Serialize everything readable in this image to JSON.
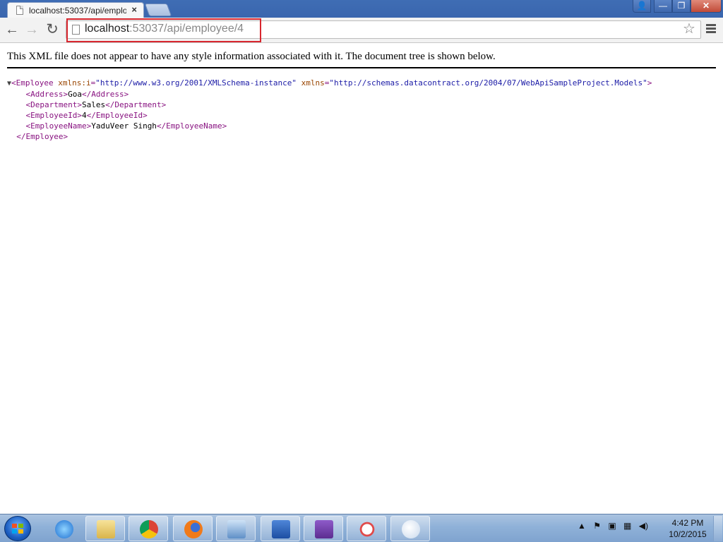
{
  "browser": {
    "tab": {
      "title": "localhost:53037/api/emplo",
      "close": "×"
    },
    "window_buttons": {
      "user": "👤",
      "minimize": "—",
      "maximize": "❐",
      "close": "✕"
    },
    "nav": {
      "back": "←",
      "forward": "→",
      "reload": "↻"
    },
    "address": {
      "host": "localhost",
      "rest": ":53037/api/employee/4"
    },
    "star": "☆"
  },
  "page": {
    "notice": "This XML file does not appear to have any style information associated with it. The document tree is shown below.",
    "xml": {
      "arrow": "▼",
      "root_open": "<Employee",
      "attr1_name": "xmlns:i",
      "attr1_value": "\"http://www.w3.org/2001/XMLSchema-instance\"",
      "attr2_name": "xmlns",
      "attr2_value": "\"http://schemas.datacontract.org/2004/07/WebApiSampleProject.Models\"",
      "root_open_end": ">",
      "fields": [
        {
          "open": "<Address>",
          "value": "Goa",
          "close": "</Address>"
        },
        {
          "open": "<Department>",
          "value": "Sales",
          "close": "</Department>"
        },
        {
          "open": "<EmployeeId>",
          "value": "4",
          "close": "</EmployeeId>"
        },
        {
          "open": "<EmployeeName>",
          "value": "YaduVeer Singh",
          "close": "</EmployeeName>"
        }
      ],
      "root_close": "</Employee>"
    }
  },
  "taskbar": {
    "apps": [
      "internet-explorer",
      "file-explorer",
      "chrome",
      "firefox",
      "control-panel",
      "word",
      "visual-studio",
      "snipping-tool",
      "paint"
    ],
    "tray": {
      "expand": "▲"
    },
    "clock": {
      "time": "4:42 PM",
      "date": "10/2/2015"
    }
  }
}
